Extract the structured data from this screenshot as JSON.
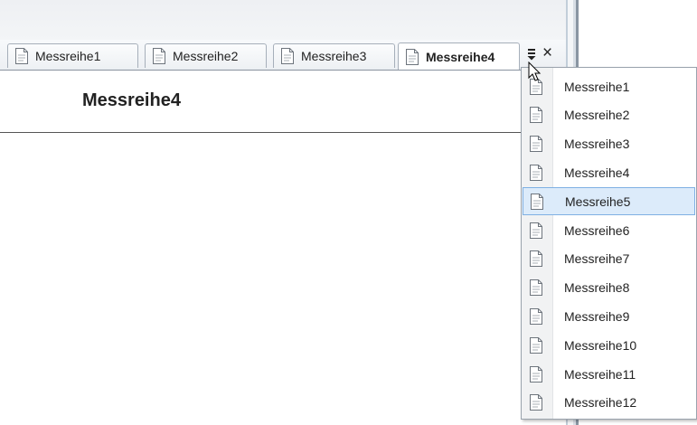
{
  "tabs": [
    {
      "label": "Messreihe1",
      "active": false
    },
    {
      "label": "Messreihe2",
      "active": false
    },
    {
      "label": "Messreihe3",
      "active": false
    },
    {
      "label": "Messreihe4",
      "active": true
    }
  ],
  "tab_overflow_icon": "tab-list-dropdown-icon",
  "close_label": "×",
  "page": {
    "title": "Messreihe4"
  },
  "dropdown": {
    "highlighted_index": 4,
    "items": [
      {
        "label": "Messreihe1"
      },
      {
        "label": "Messreihe2"
      },
      {
        "label": "Messreihe3"
      },
      {
        "label": "Messreihe4"
      },
      {
        "label": "Messreihe5"
      },
      {
        "label": "Messreihe6"
      },
      {
        "label": "Messreihe7"
      },
      {
        "label": "Messreihe8"
      },
      {
        "label": "Messreihe9"
      },
      {
        "label": "Messreihe10"
      },
      {
        "label": "Messreihe11"
      },
      {
        "label": "Messreihe12"
      }
    ]
  },
  "colors": {
    "highlight_bg": "#dcebfa",
    "highlight_border": "#7fb0e3"
  }
}
